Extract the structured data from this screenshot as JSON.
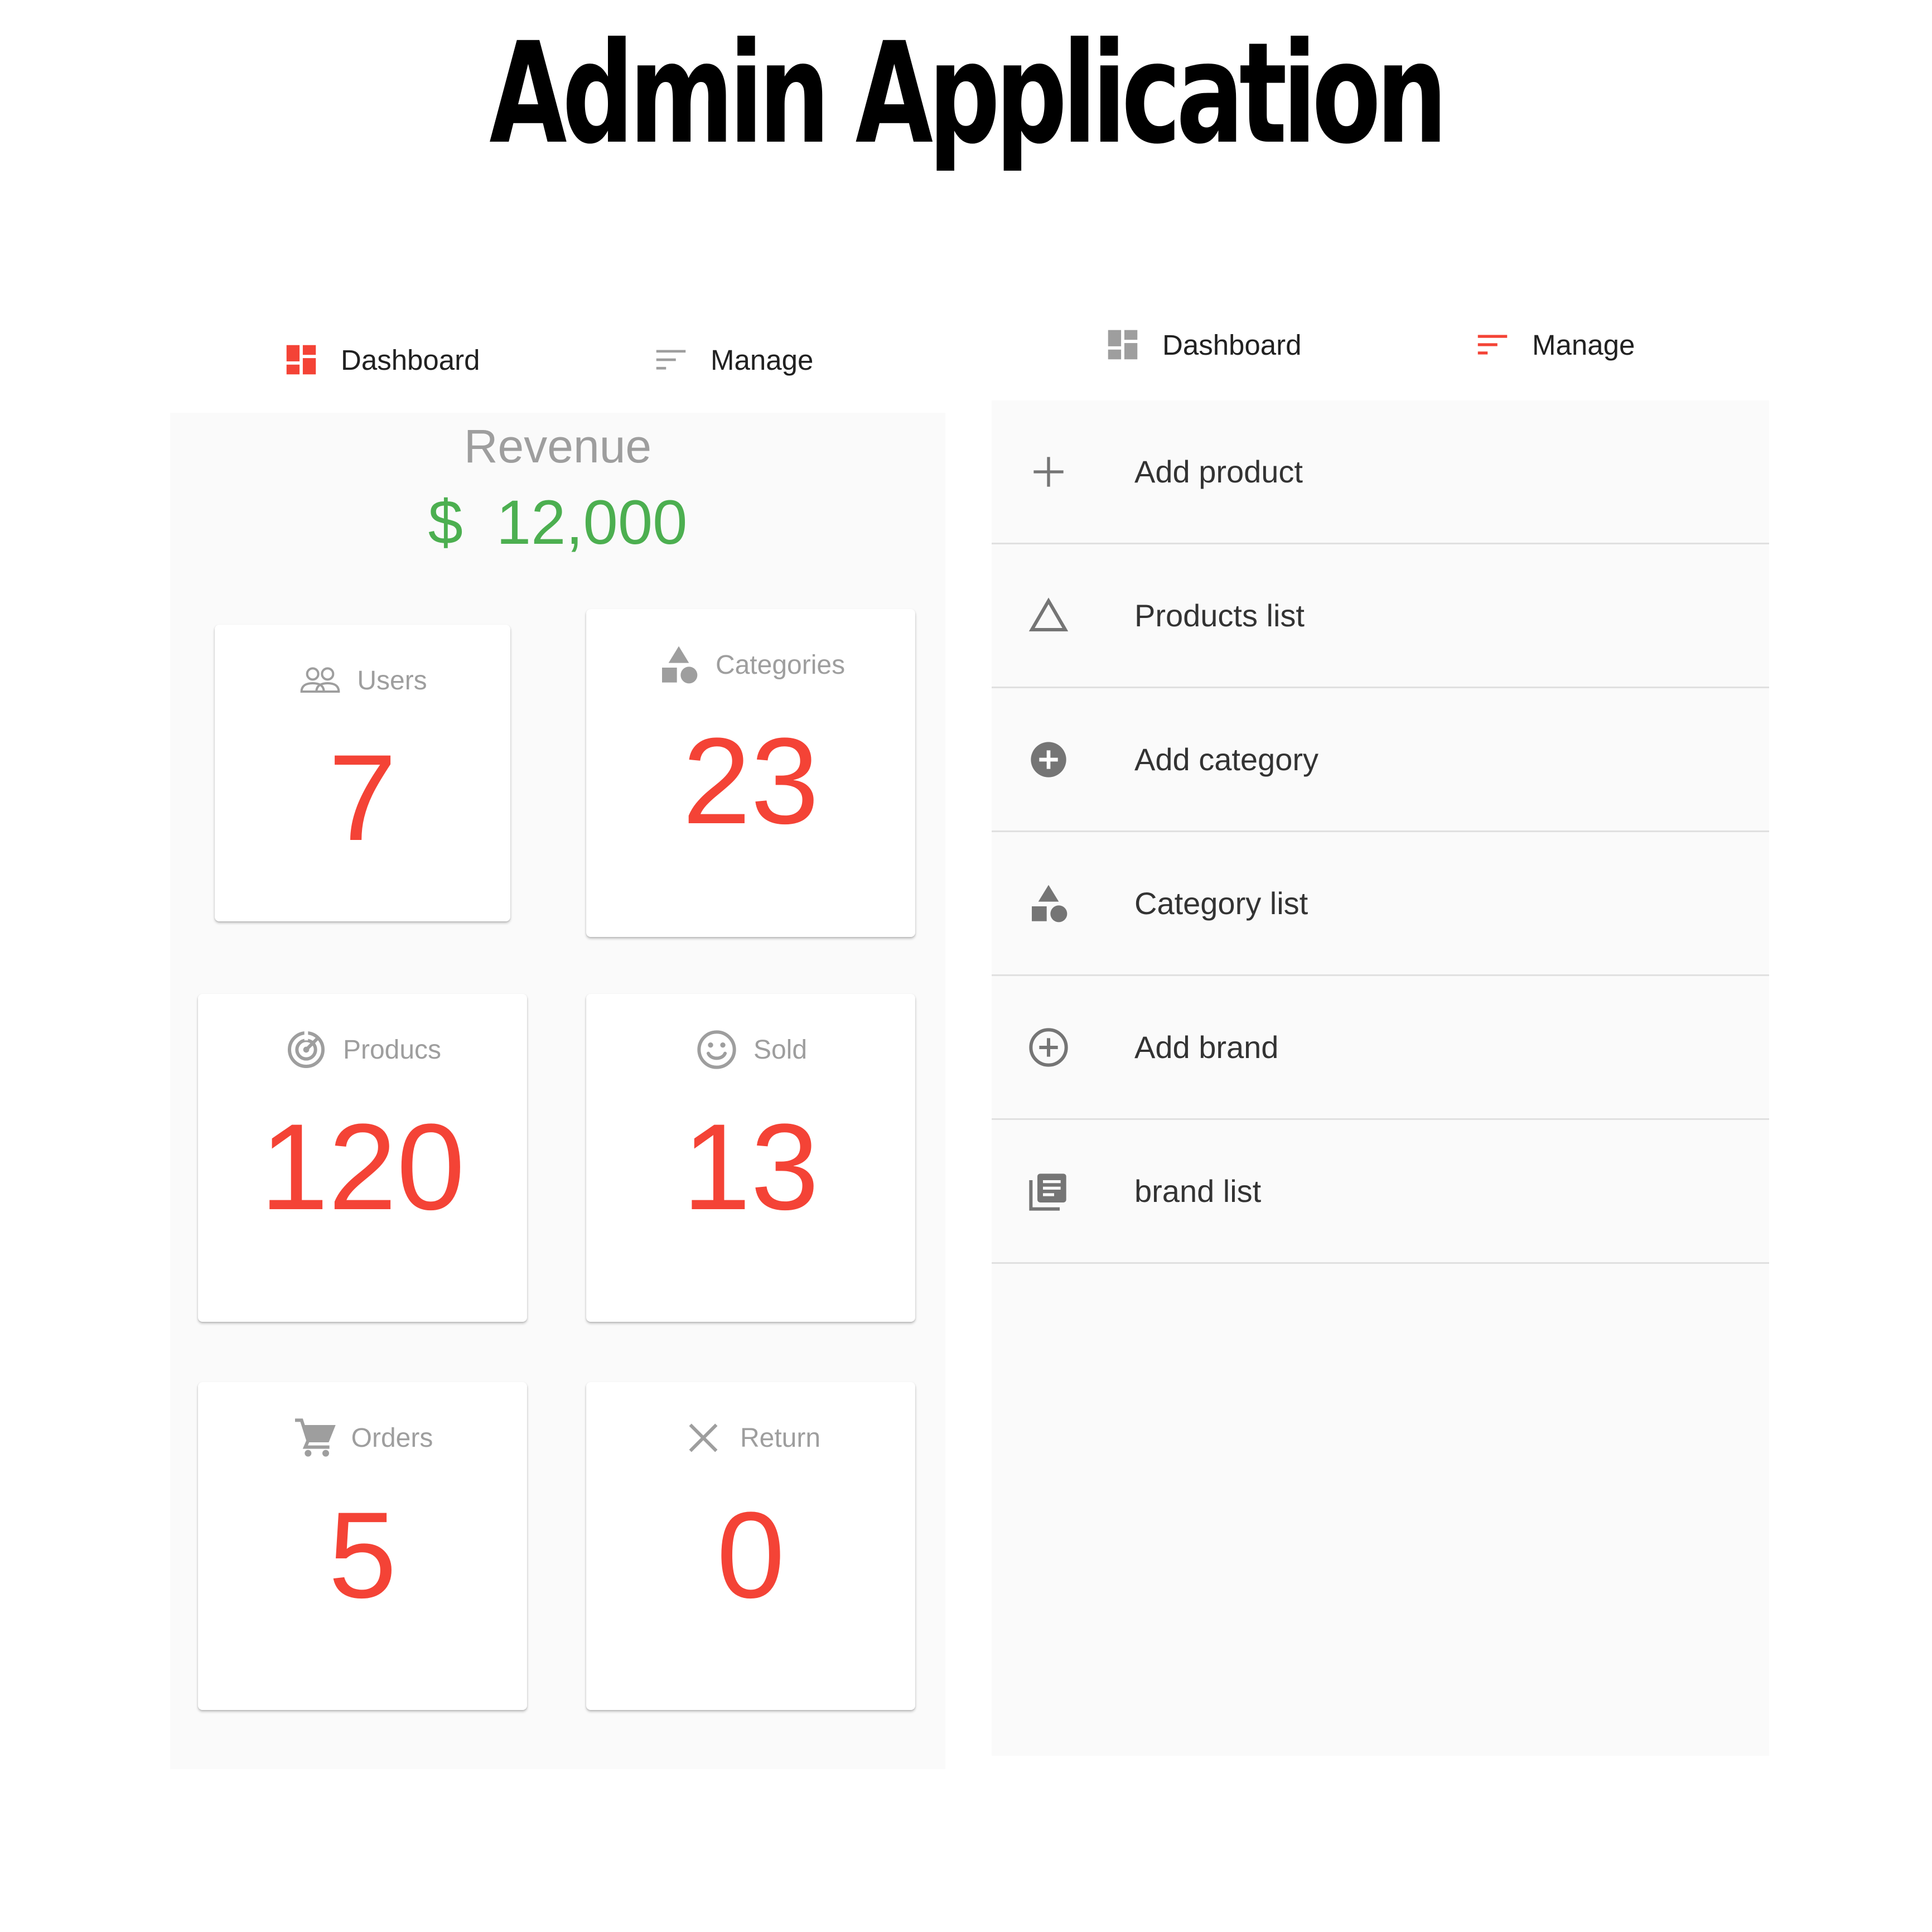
{
  "title": "Admin Application",
  "left_screen": {
    "tabs": [
      {
        "label": "Dashboard",
        "icon": "dashboard-icon",
        "active": true
      },
      {
        "label": "Manage",
        "icon": "sort-icon",
        "active": false
      }
    ],
    "revenue": {
      "title": "Revenue",
      "currency": "$",
      "amount": "12,000"
    },
    "stats": [
      {
        "label": "Users",
        "icon": "people-outline-icon",
        "value": "7"
      },
      {
        "label": "Categories",
        "icon": "category-icon",
        "value": "23"
      },
      {
        "label": "Producs",
        "icon": "track-changes-icon",
        "value": "120"
      },
      {
        "label": "Sold",
        "icon": "smiley-icon",
        "value": "13"
      },
      {
        "label": "Orders",
        "icon": "shopping-cart-icon",
        "value": "5"
      },
      {
        "label": "Return",
        "icon": "close-icon",
        "value": "0"
      }
    ]
  },
  "right_screen": {
    "tabs": [
      {
        "label": "Dashboard",
        "icon": "dashboard-icon",
        "active": false
      },
      {
        "label": "Manage",
        "icon": "sort-icon",
        "active": true
      }
    ],
    "menu": [
      {
        "label": "Add product",
        "icon": "add-icon"
      },
      {
        "label": "Products list",
        "icon": "triangle-outline-icon"
      },
      {
        "label": "Add category",
        "icon": "add-circle-icon"
      },
      {
        "label": "Category list",
        "icon": "category-icon"
      },
      {
        "label": "Add brand",
        "icon": "add-circle-outline-icon"
      },
      {
        "label": "brand list",
        "icon": "library-books-icon"
      }
    ]
  },
  "colors": {
    "accent": "#f44336",
    "revenue": "#4caf50",
    "muted": "#9e9e9e",
    "panel_bg": "#fafafa"
  }
}
